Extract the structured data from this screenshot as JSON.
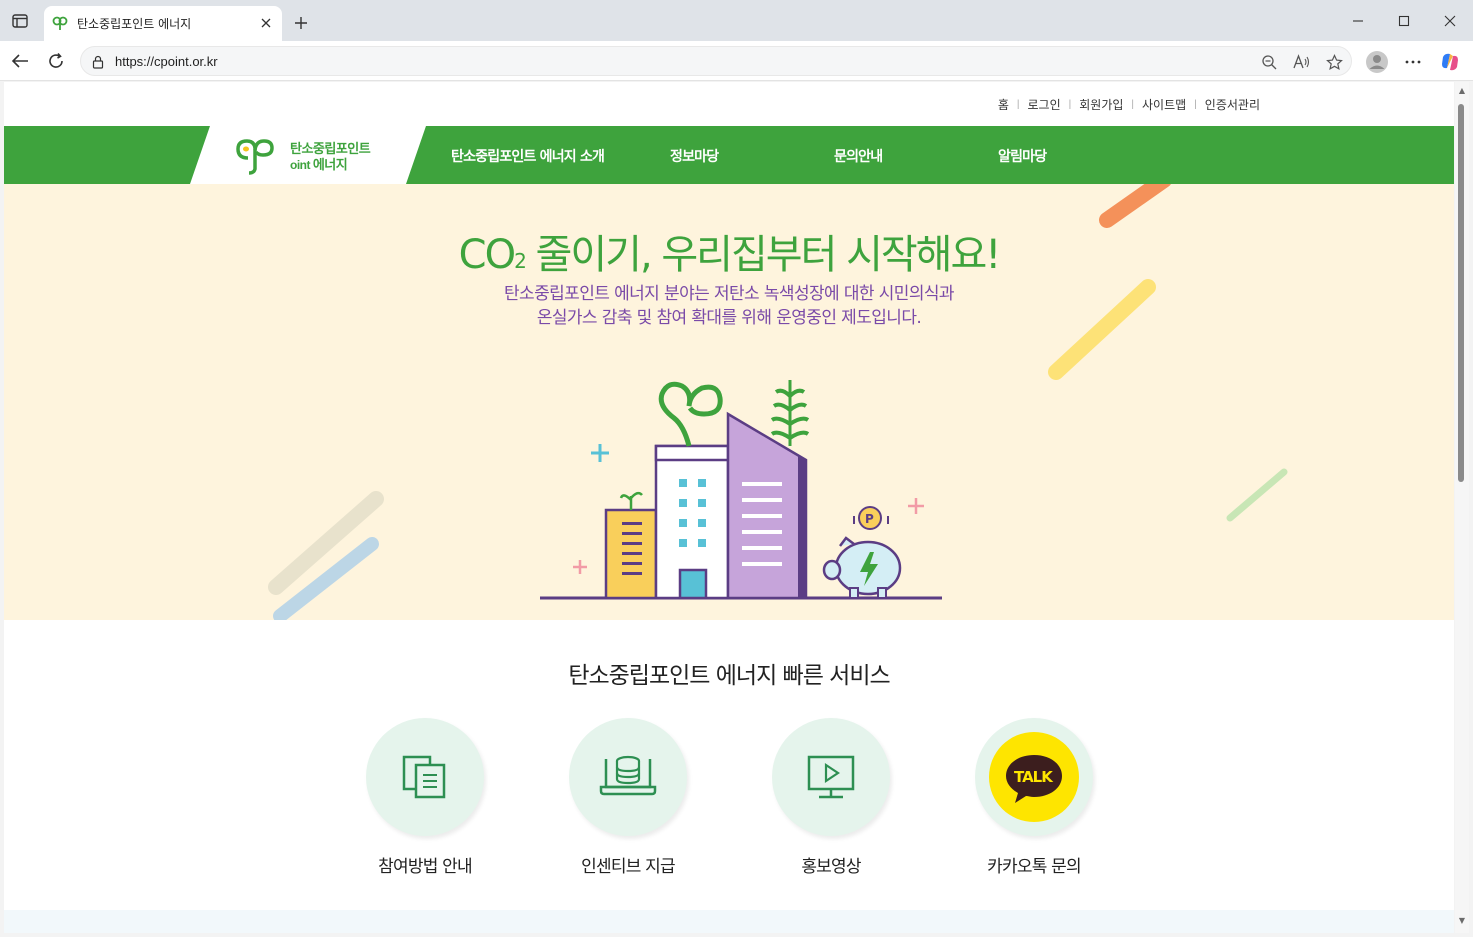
{
  "browser": {
    "tab_title": "탄소중립포인트 에너지",
    "url": "https://cpoint.or.kr"
  },
  "util_links": [
    "홈",
    "로그인",
    "회원가입",
    "사이트맵",
    "인증서관리"
  ],
  "logo": {
    "line1": "탄소중립포인트",
    "line2": "에너지",
    "mark": "Point"
  },
  "gnb": [
    "탄소중립포인트 에너지 소개",
    "정보마당",
    "문의안내",
    "알림마당"
  ],
  "hero": {
    "title_co": "CO",
    "title_sub": "2",
    "title_rest": " 줄이기, 우리집부터 시작해요!",
    "desc_line1": "탄소중립포인트 에너지 분야는 저탄소 녹색성장에 대한 시민의식과",
    "desc_line2": "온실가스 감축 및 참여 확대를 위해 운영중인 제도입니다."
  },
  "services": {
    "title": "탄소중립포인트 에너지 빠른 서비스",
    "items": [
      {
        "label": "참여방법 안내",
        "icon": "documents-icon"
      },
      {
        "label": "인센티브 지급",
        "icon": "laptop-coins-icon"
      },
      {
        "label": "홍보영상",
        "icon": "video-play-icon"
      },
      {
        "label": "카카오톡 문의",
        "icon": "kakaotalk-icon",
        "badge": "TALK"
      }
    ]
  },
  "colors": {
    "brand_green": "#3ea33d",
    "hero_bg": "#fef4dd",
    "hero_desc": "#7a4aa8",
    "kakao_yellow": "#fee500"
  }
}
